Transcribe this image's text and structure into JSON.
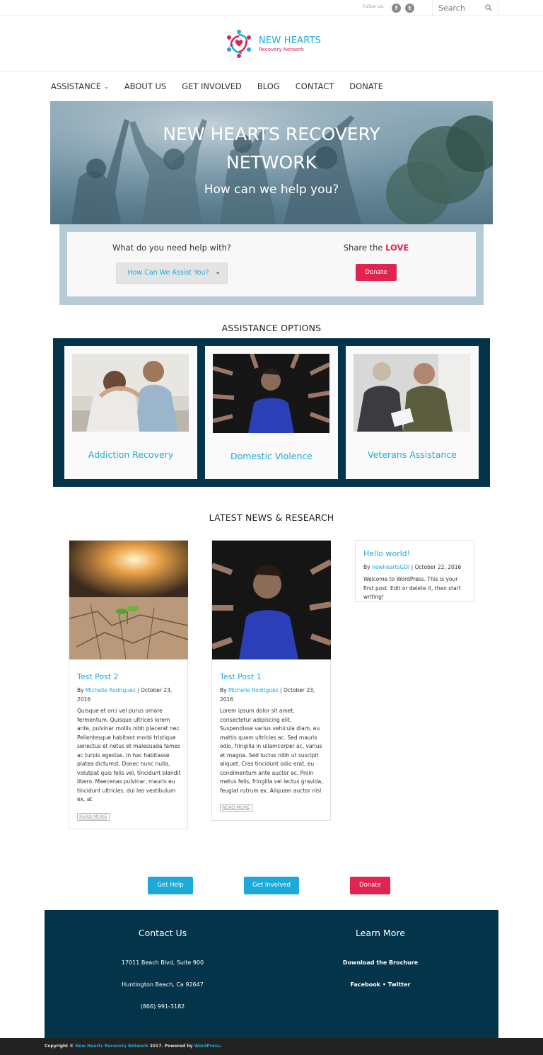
{
  "topbar": {
    "follow_label": "Follow Us:",
    "search_placeholder": "Search",
    "social": [
      "facebook-icon",
      "twitter-icon"
    ]
  },
  "logo": {
    "title": "NEW HEARTS",
    "subtitle": "Recovery Network"
  },
  "nav": {
    "items": [
      "ASSISTANCE",
      "ABOUT US",
      "GET INVOLVED",
      "BLOG",
      "CONTACT",
      "DONATE"
    ]
  },
  "hero": {
    "title_line1": "NEW HEARTS RECOVERY",
    "title_line2": "NETWORK",
    "subtitle": "How can we help you?"
  },
  "help": {
    "question": "What do you need help with?",
    "select_value": "How Can We Assist You?",
    "share_prefix": "Share the",
    "share_highlight": "LOVE",
    "donate_label": "Donate"
  },
  "assistance": {
    "title": "ASSISTANCE OPTIONS",
    "cards": [
      "Addiction Recovery",
      "Domestic Violence",
      "Veterans Assistance"
    ]
  },
  "news": {
    "title": "LATEST NEWS & RESEARCH",
    "posts": [
      {
        "title": "Test Post 2",
        "by": "By",
        "author": "Michelle Rodriguez",
        "date_part1": "| October 23,",
        "date_part2": "2016",
        "body": "Quisque et orci vel purus ornare fermentum. Quisque ultrices lorem ante, pulvinar mollis nibh placerat nec. Pellentesque habitant morbi tristique senectus et netus et malesuada fames ac turpis egestas. In hac habitasse platea dictumst. Donec nunc nulla, volutpat quis felis vel, tincidunt blandit libero. Maecenas pulvinar, mauris eu tincidunt ultricies, dui leo vestibulum ex, at",
        "read_more": "READ MORE"
      },
      {
        "title": "Test Post 1",
        "by": "By",
        "author": "Michelle Rodriguez",
        "date_part1": "| October 23,",
        "date_part2": "2016",
        "body": "Lorem ipsum dolor sit amet, consectetur adipiscing elit. Suspendisse varius vehicula diam, eu mattis quam ultricies ac. Sed mauris odio, fringilla in ullamcorper ac, varius et magna. Sed luctus nibh ut suscipit aliquet. Cras tincidunt odio erat, eu condimentum ante auctor ac. Proin metus felis, fringilla vel lectus gravida, feugiat rutrum ex. Aliquam auctor nisl",
        "read_more": "READ MORE"
      }
    ],
    "widget": {
      "title": "Hello world!",
      "by": "By",
      "author": "newheartsGDI",
      "date": "| October 22, 2016",
      "body": "Welcome to WordPress. This is your first post. Edit or delete it, then start writing!"
    }
  },
  "cta": {
    "get_help": "Get Help",
    "get_involved": "Get Involved",
    "donate": "Donate"
  },
  "footer": {
    "contact_title": "Contact Us",
    "address1": "17011 Beach Blvd, Suite 900",
    "address2": "Huntington Beach, Ca 92647",
    "phone": "(866) 991-3182",
    "learn_title": "Learn More",
    "brochure": "Download the Brochure",
    "social_links": "Facebook • Twitter",
    "copy_prefix": "Copyright ©",
    "copy_site": "New Hearts Recovery Network",
    "copy_mid": "2017. Powered by",
    "copy_wp": "WordPress",
    "copy_end": "."
  },
  "colors": {
    "accent_blue": "#1eaad9",
    "accent_red": "#e0234f",
    "navy": "#03344a"
  }
}
